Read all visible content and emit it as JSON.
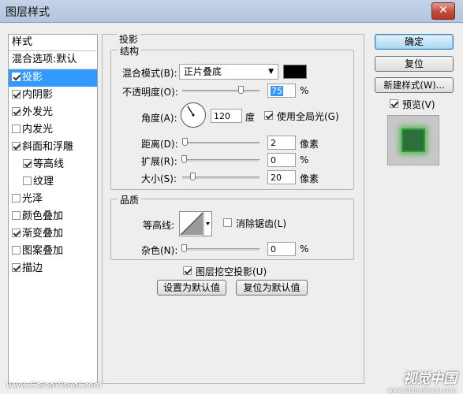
{
  "window": {
    "title": "图层样式",
    "close_label": "✕"
  },
  "style_list": {
    "header": "样式",
    "items": [
      {
        "label": "混合选项:默认",
        "checkbox": false,
        "checked": false,
        "selected": false,
        "sub": false
      },
      {
        "label": "投影",
        "checkbox": true,
        "checked": true,
        "selected": true,
        "sub": false
      },
      {
        "label": "内阴影",
        "checkbox": true,
        "checked": true,
        "selected": false,
        "sub": false
      },
      {
        "label": "外发光",
        "checkbox": true,
        "checked": true,
        "selected": false,
        "sub": false
      },
      {
        "label": "内发光",
        "checkbox": true,
        "checked": false,
        "selected": false,
        "sub": false
      },
      {
        "label": "斜面和浮雕",
        "checkbox": true,
        "checked": true,
        "selected": false,
        "sub": false
      },
      {
        "label": "等高线",
        "checkbox": true,
        "checked": true,
        "selected": false,
        "sub": true
      },
      {
        "label": "纹理",
        "checkbox": true,
        "checked": false,
        "selected": false,
        "sub": true
      },
      {
        "label": "光泽",
        "checkbox": true,
        "checked": false,
        "selected": false,
        "sub": false
      },
      {
        "label": "颜色叠加",
        "checkbox": true,
        "checked": false,
        "selected": false,
        "sub": false
      },
      {
        "label": "渐变叠加",
        "checkbox": true,
        "checked": true,
        "selected": false,
        "sub": false
      },
      {
        "label": "图案叠加",
        "checkbox": true,
        "checked": false,
        "selected": false,
        "sub": false
      },
      {
        "label": "描边",
        "checkbox": true,
        "checked": true,
        "selected": false,
        "sub": false
      }
    ]
  },
  "drop_shadow": {
    "title": "投影",
    "structure": {
      "title": "结构",
      "blend_mode_label": "混合模式(B):",
      "blend_mode_value": "正片叠底",
      "blend_color": "#000000",
      "opacity_label": "不透明度(O):",
      "opacity_value": "75",
      "opacity_unit": "%",
      "opacity_fraction": 0.75,
      "angle_label": "角度(A):",
      "angle_value": "120",
      "angle_unit": "度",
      "global_light_label": "使用全局光(G)",
      "global_light_checked": true,
      "distance_label": "距离(D):",
      "distance_value": "2",
      "distance_unit": "像素",
      "spread_label": "扩展(R):",
      "spread_value": "0",
      "spread_unit": "%",
      "size_label": "大小(S):",
      "size_value": "20",
      "size_unit": "像素"
    },
    "quality": {
      "title": "品质",
      "contour_label": "等高线:",
      "anti_alias_label": "消除锯齿(L)",
      "anti_alias_checked": false,
      "noise_label": "杂色(N):",
      "noise_value": "0",
      "noise_unit": "%"
    },
    "knockout_label": "图层挖空投影(U)",
    "knockout_checked": true,
    "make_default_label": "设置为默认值",
    "reset_default_label": "复位为默认值"
  },
  "buttons": {
    "ok": "确定",
    "reset": "复位",
    "new_style": "新建样式(W)...",
    "preview_label": "预览(V)",
    "preview_checked": true
  },
  "watermark": {
    "left": "www.ChinaVisual.com",
    "right_big": "视觉中国",
    "right_small": "www.ChinaVisual.com"
  }
}
